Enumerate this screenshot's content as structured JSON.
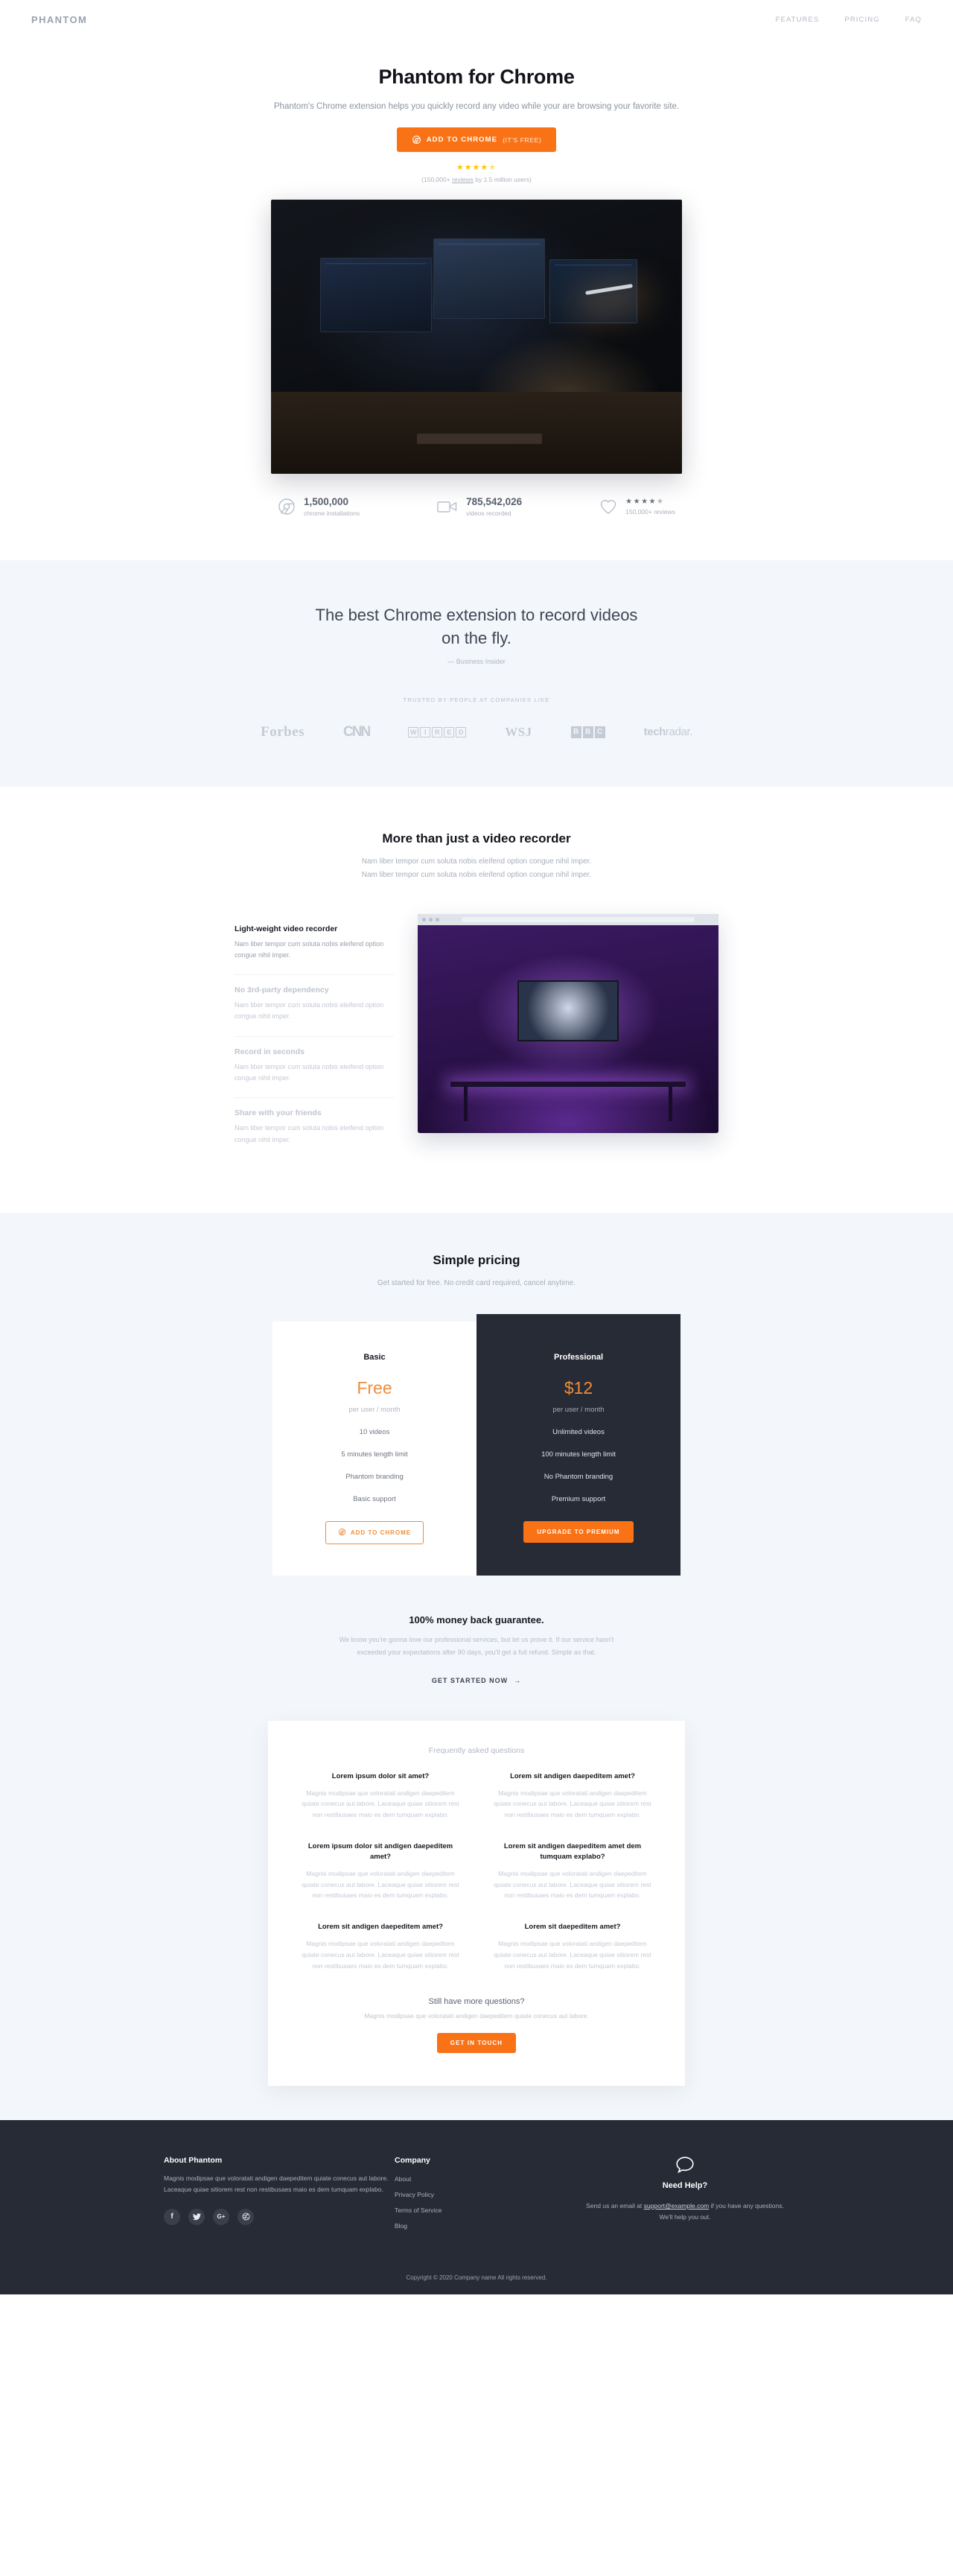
{
  "nav": {
    "logo": "PHANTOM",
    "links": [
      {
        "label": "FEATURES"
      },
      {
        "label": "PRICING"
      },
      {
        "label": "FAQ"
      }
    ]
  },
  "hero": {
    "title": "Phantom for Chrome",
    "subtitle": "Phantom's Chrome extension helps you quickly record any video while your are browsing your favorite site.",
    "cta_label": "ADD TO CHROME",
    "cta_note": "(IT'S FREE)",
    "stars": "★★★★",
    "half_star": "★",
    "rating_prefix": "(150,000+ ",
    "rating_link": "reviews",
    "rating_suffix": " by 1.5 million users)"
  },
  "stats": [
    {
      "icon": "chrome-icon",
      "number": "1,500,000",
      "label": "chrome installations"
    },
    {
      "icon": "video-camera-icon",
      "number": "785,542,026",
      "label": "videos recorded"
    },
    {
      "icon": "heart-icon",
      "stars": "★★★★",
      "half": "★",
      "label": "150,000+ reviews"
    }
  ],
  "quote": {
    "text_line1": "The best Chrome extension to record videos",
    "text_line2": "on the fly.",
    "source": "— Business Insider",
    "trusted_label": "TRUSTED BY PEOPLE AT COMPANIES LIKE",
    "logos": [
      {
        "name": "Forbes"
      },
      {
        "name": "CNN"
      },
      {
        "name": "WIRED",
        "letters": [
          "W",
          "I",
          "R",
          "E",
          "D"
        ]
      },
      {
        "name": "WSJ"
      },
      {
        "name": "BBC",
        "letters": [
          "B",
          "B",
          "C"
        ]
      },
      {
        "name": "techradar",
        "bold": "tech",
        "light": "radar."
      }
    ]
  },
  "features": {
    "title": "More than just a video recorder",
    "subtitle": "Nam liber tempor cum soluta nobis eleifend option congue nihil imper. Nam liber tempor cum soluta nobis eleifend option congue nihil imper.",
    "items": [
      {
        "title": "Light-weight video recorder",
        "body": "Nam liber tempor cum soluta nobis eleifend option congue nihil imper.",
        "active": true
      },
      {
        "title": "No 3rd-party dependency",
        "body": "Nam liber tempor cum soluta nobis eleifend option congue nihil imper.",
        "active": false
      },
      {
        "title": "Record in seconds",
        "body": "Nam liber tempor cum soluta nobis eleifend option congue nihil imper.",
        "active": false
      },
      {
        "title": "Share with your friends",
        "body": "Nam liber tempor cum soluta nobis eleifend option congue nihil imper.",
        "active": false
      }
    ]
  },
  "pricing": {
    "title": "Simple pricing",
    "subtitle": "Get started for free. No credit card required, cancel anytime.",
    "basic": {
      "name": "Basic",
      "price": "Free",
      "per": "per user / month",
      "features": [
        "10 videos",
        "5 minutes length limit",
        "Phantom branding",
        "Basic support"
      ],
      "cta": "ADD TO CHROME"
    },
    "pro": {
      "name": "Professional",
      "price": "$12",
      "per": "per user / month",
      "features": [
        "Unlimited videos",
        "100 minutes length limit",
        "No Phantom branding",
        "Premium support"
      ],
      "cta": "UPGRADE TO PREMIUM"
    }
  },
  "guarantee": {
    "title": "100% money back guarantee.",
    "body": "We know you're gonna love our professional services, but let us prove it. If our service hasn't exceeded your expectations after 90 days, you'll get a full refund. Simple as that.",
    "link": "GET STARTED NOW",
    "arrow": "→"
  },
  "faq": {
    "title": "Frequently asked questions",
    "items": [
      {
        "q": "Lorem ipsum dolor sit amet?",
        "a": "Magnis modipsae que voloratati andigen daepeditem quiate conecus aut labore. Laceaque quiae sitiorem rest non restibusaes maio es dem tumquam explabo."
      },
      {
        "q": "Lorem sit andigen daepeditem amet?",
        "a": "Magnis modipsae que voloratati andigen daepeditem quiate conecus aut labore. Laceaque quiae sitiorem rest non restibusaes maio es dem tumquam explabo."
      },
      {
        "q": "Lorem ipsum dolor sit andigen daepeditem amet?",
        "a": "Magnis modipsae que voloratati andigen daepeditem quiate conecus aut labore. Laceaque quiae sitiorem rest non restibusaes maio es dem tumquam explabo."
      },
      {
        "q": "Lorem sit andigen daepeditem amet dem tumquam explabo?",
        "a": "Magnis modipsae que voloratati andigen daepeditem quiate conecus aut labore. Laceaque quiae sitiorem rest non restibusaes maio es dem tumquam explabo."
      },
      {
        "q": "Lorem sit andigen daepeditem amet?",
        "a": "Magnis modipsae que voloratati andigen daepeditem quiate conecus aut labore. Laceaque quiae sitiorem rest non restibusaes maio es dem tumquam explabo."
      },
      {
        "q": "Lorem sit daepeditem amet?",
        "a": "Magnis modipsae que voloratati andigen daepeditem quiate conecus aut labore. Laceaque quiae sitiorem rest non restibusaes maio es dem tumquam explabo."
      }
    ],
    "more_title": "Still have more questions?",
    "more_body": "Magnis modipsae que voloratati andigen daepeditem quiate conecus aut labore.",
    "more_cta": "GET IN TOUCH"
  },
  "footer": {
    "about_title": "About Phantom",
    "about_body": "Magnis modipsae que voloratati andigen daepeditem quiate conecus aut labore. Laceaque quiae sitiorem rest non restibusaes maio es dem tumquam explabo.",
    "socials": [
      {
        "icon": "facebook-icon",
        "glyph": "f"
      },
      {
        "icon": "twitter-icon",
        "glyph": "🐦"
      },
      {
        "icon": "google-plus-icon",
        "glyph": "G+"
      },
      {
        "icon": "dribbble-icon",
        "glyph": "◉"
      }
    ],
    "company_title": "Company",
    "company_links": [
      {
        "label": "About"
      },
      {
        "label": "Privacy Policy"
      },
      {
        "label": "Terms of Service"
      },
      {
        "label": "Blog"
      }
    ],
    "help_title": "Need Help?",
    "help_pre": "Send us an email at ",
    "help_email": "support@example.com",
    "help_post": " if you have any questions. We'll help you out.",
    "copyright": "Copyright © 2020 Company name All rights reserved."
  },
  "colors": {
    "accent": "#f97316",
    "accent_soft": "#f08c3a",
    "dark": "#272b35",
    "band": "#f3f6fa",
    "star": "#fdc500"
  }
}
